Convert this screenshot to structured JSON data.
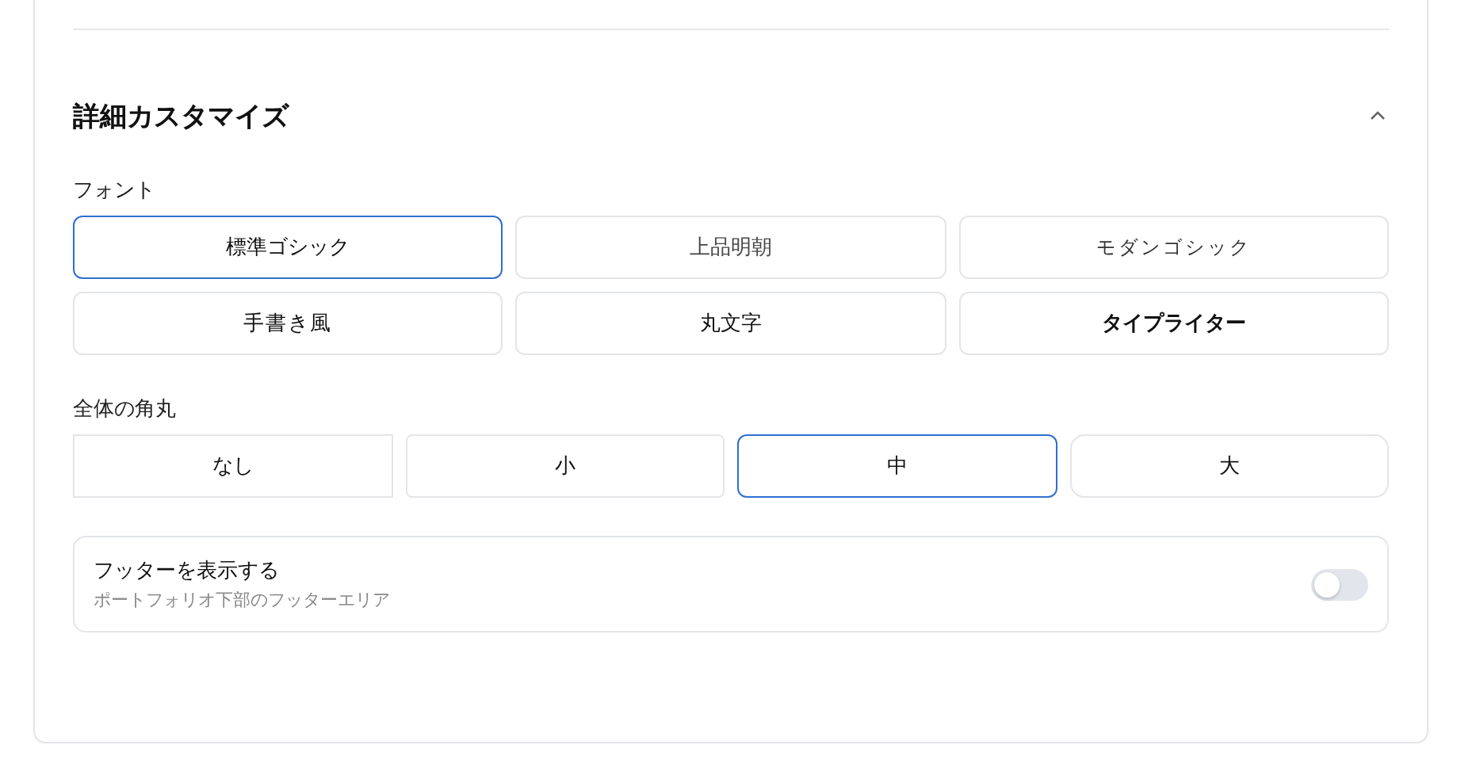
{
  "section": {
    "title": "詳細カスタマイズ",
    "expanded": true
  },
  "font": {
    "label": "フォント",
    "options": [
      {
        "label": "標準ゴシック",
        "kind": "gothic",
        "selected": true
      },
      {
        "label": "上品明朝",
        "kind": "mincho",
        "selected": false
      },
      {
        "label": "モダンゴシック",
        "kind": "modern",
        "selected": false
      },
      {
        "label": "手書き風",
        "kind": "handwriting",
        "selected": false
      },
      {
        "label": "丸文字",
        "kind": "rounded",
        "selected": false
      },
      {
        "label": "タイプライター",
        "kind": "typewriter",
        "selected": false
      }
    ]
  },
  "radius": {
    "label": "全体の角丸",
    "options": [
      {
        "label": "なし",
        "kind": "none",
        "selected": false
      },
      {
        "label": "小",
        "kind": "small",
        "selected": false
      },
      {
        "label": "中",
        "kind": "medium",
        "selected": true
      },
      {
        "label": "大",
        "kind": "large",
        "selected": false
      }
    ]
  },
  "footer_setting": {
    "title": "フッターを表示する",
    "description": "ポートフォリオ下部のフッターエリア",
    "on": false
  }
}
